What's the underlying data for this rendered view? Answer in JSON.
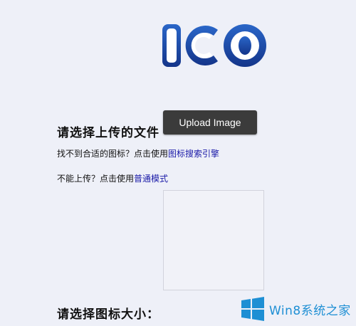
{
  "logo": {
    "text": "ICO",
    "icon": "ico-logo"
  },
  "upload": {
    "title": "请选择上传的文件",
    "button_label": "Upload Image",
    "help_line1_prefix": "找不到合适的图标？点击使用",
    "help_line1_link": "图标搜索引擎",
    "help_line2_prefix": "不能上传？点击使用",
    "help_line2_link": "普通模式"
  },
  "preview": {
    "icon": "empty-preview"
  },
  "size": {
    "title": "请选择图标大小："
  },
  "watermark": {
    "text": "Win8系统之家",
    "icon": "windows-logo-icon"
  },
  "colors": {
    "background": "#eef0f8",
    "button": "#3b3b3b",
    "link": "#1a1aa8",
    "watermark": "#1e8fd4",
    "logo_blue": "#1f4fae"
  }
}
